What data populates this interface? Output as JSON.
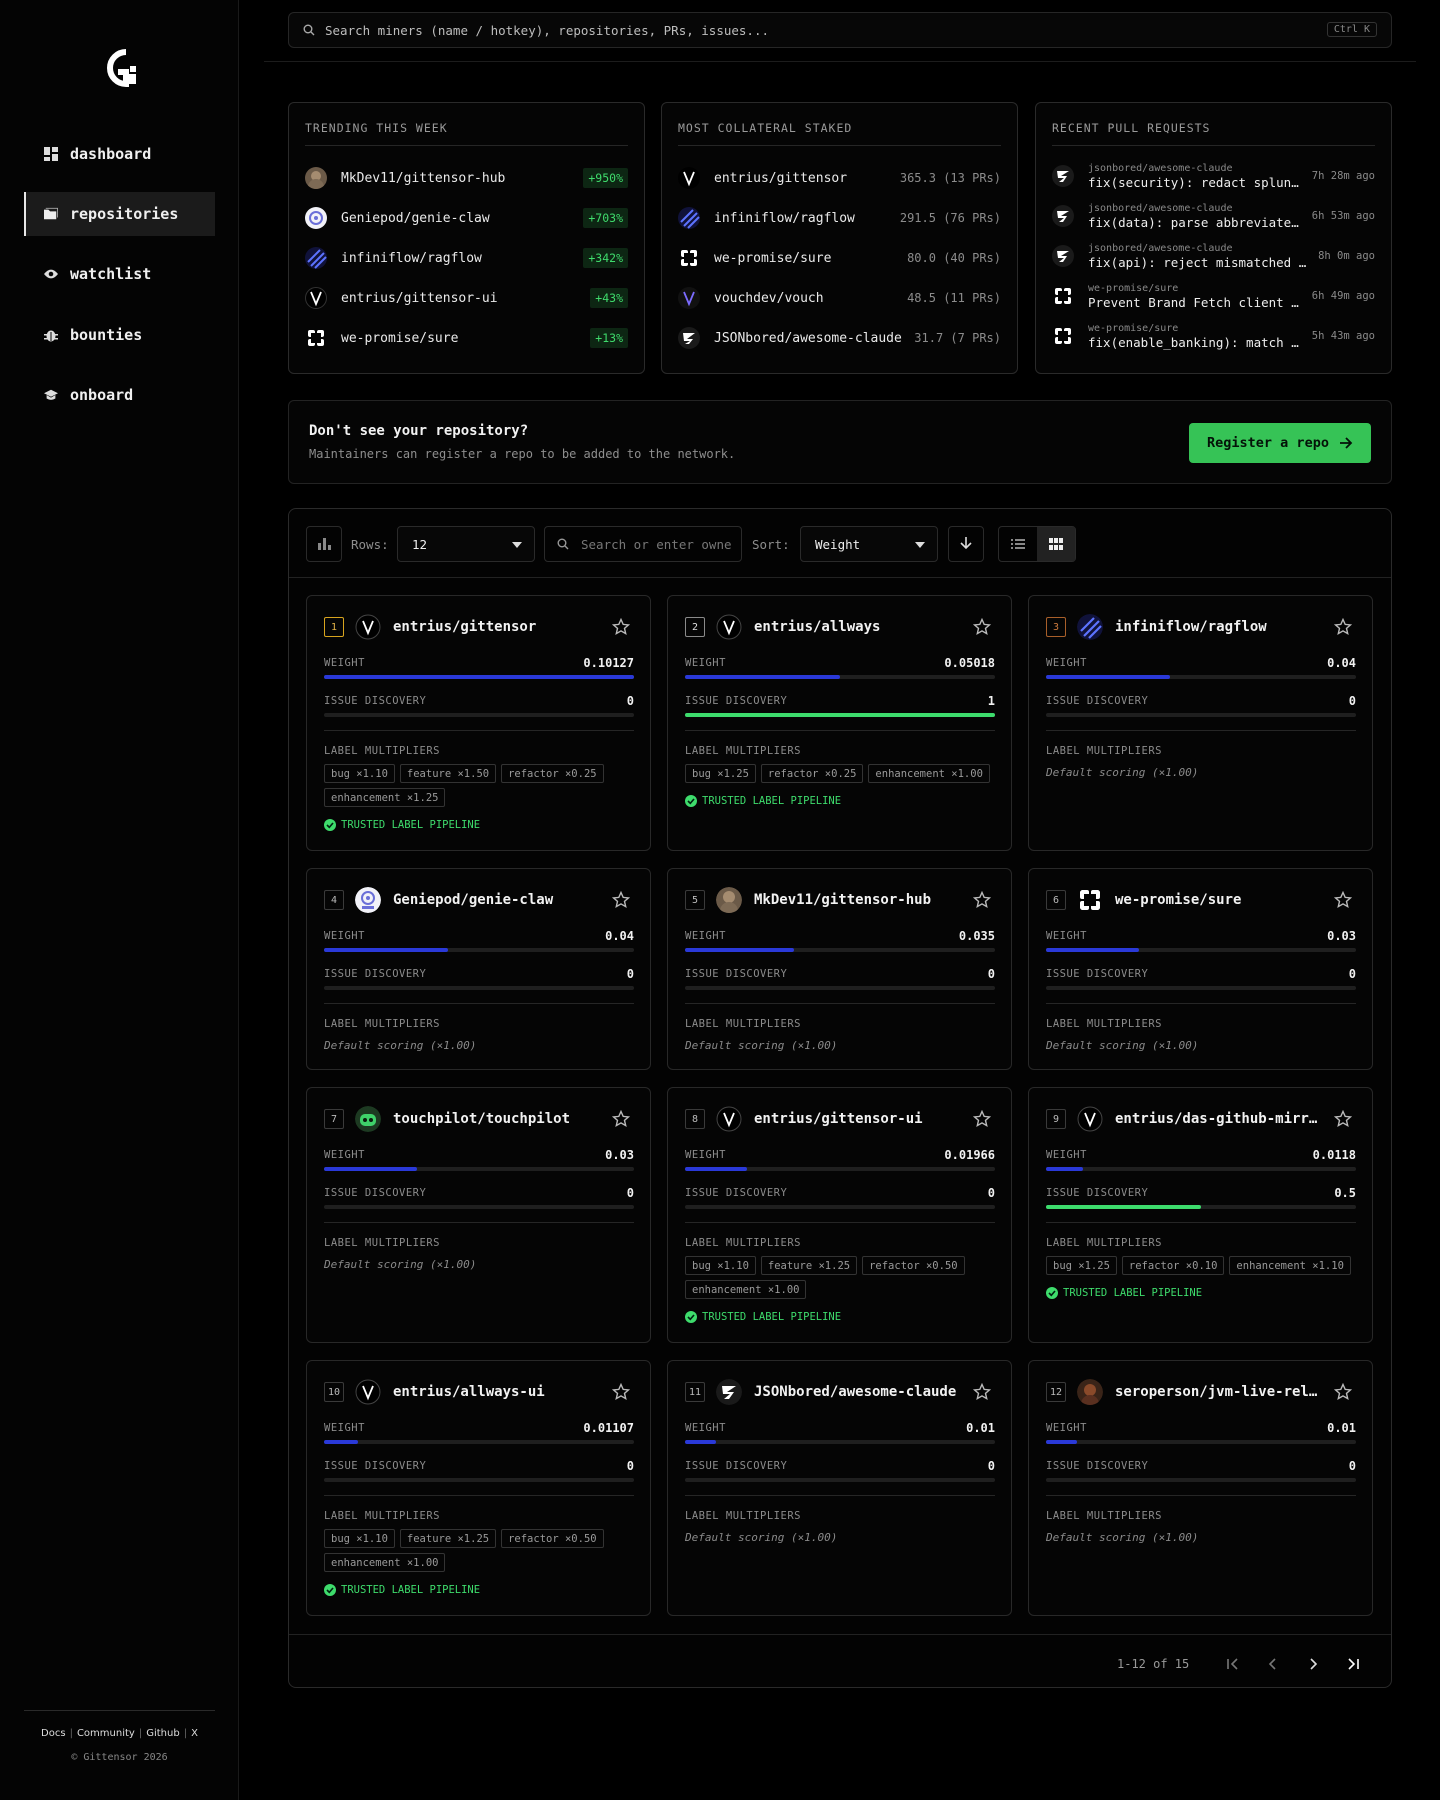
{
  "sidebar": {
    "nav": [
      {
        "label": "dashboard",
        "icon": "dashboard-icon"
      },
      {
        "label": "repositories",
        "icon": "folder-icon",
        "active": true
      },
      {
        "label": "watchlist",
        "icon": "eye-icon"
      },
      {
        "label": "bounties",
        "icon": "bug-icon"
      },
      {
        "label": "onboard",
        "icon": "graduation-cap-icon"
      }
    ],
    "footer_links": [
      "Docs",
      "Community",
      "Github",
      "X"
    ],
    "copyright": "© Gittensor 2026"
  },
  "search": {
    "placeholder": "Search miners (name / hotkey), repositories, PRs, issues...",
    "shortcut": "Ctrl K"
  },
  "trending": {
    "title": "TRENDING THIS WEEK",
    "items": [
      {
        "name": "MkDev11/gittensor-hub",
        "change": "+950%"
      },
      {
        "name": "Geniepod/genie-claw",
        "change": "+703%"
      },
      {
        "name": "infiniflow/ragflow",
        "change": "+342%"
      },
      {
        "name": "entrius/gittensor-ui",
        "change": "+43%"
      },
      {
        "name": "we-promise/sure",
        "change": "+13%"
      }
    ]
  },
  "collateral": {
    "title": "MOST COLLATERAL STAKED",
    "items": [
      {
        "name": "entrius/gittensor",
        "stake": "365.3 (13 PRs)"
      },
      {
        "name": "infiniflow/ragflow",
        "stake": "291.5 (76 PRs)"
      },
      {
        "name": "we-promise/sure",
        "stake": "80.0 (40 PRs)"
      },
      {
        "name": "vouchdev/vouch",
        "stake": "48.5 (11 PRs)"
      },
      {
        "name": "JSONbored/awesome-claude",
        "stake": "31.7 (7 PRs)"
      }
    ]
  },
  "recent_prs": {
    "title": "RECENT PULL REQUESTS",
    "items": [
      {
        "repo": "jsonbored/awesome-claude",
        "title": "fix(security): redact splunk hec tokens",
        "ago": "7h 28m ago"
      },
      {
        "repo": "jsonbored/awesome-claude",
        "title": "fix(data): parse abbreviated dates",
        "ago": "6h 53m ago"
      },
      {
        "repo": "jsonbored/awesome-claude",
        "title": "fix(api): reject mismatched payloads",
        "ago": "8h 0m ago"
      },
      {
        "repo": "we-promise/sure",
        "title": "Prevent Brand Fetch client errors",
        "ago": "6h 49m ago"
      },
      {
        "repo": "we-promise/sure",
        "title": "fix(enable_banking): match accounts",
        "ago": "5h 43m ago"
      }
    ]
  },
  "register": {
    "heading": "Don't see your repository?",
    "subtext": "Maintainers can register a repo to be added to the network.",
    "button": "Register a repo"
  },
  "toolbar": {
    "rows_label": "Rows:",
    "rows_value": "12",
    "filter_placeholder": "Search or enter owner",
    "sort_label": "Sort:",
    "sort_value": "Weight"
  },
  "card_labels": {
    "weight": "WEIGHT",
    "issue": "ISSUE DISCOVERY",
    "multipliers": "LABEL MULTIPLIERS",
    "default_scoring": "Default scoring (×1.00)",
    "trusted": "TRUSTED LABEL PIPELINE"
  },
  "repos": [
    {
      "rank": "1",
      "name": "entrius/gittensor",
      "weight": "0.10127",
      "weight_pct": 100,
      "issue": "0",
      "issue_pct": 0,
      "multipliers": [
        "bug ×1.10",
        "feature ×1.50",
        "refactor ×0.25",
        "enhancement ×1.25"
      ],
      "trusted": true
    },
    {
      "rank": "2",
      "name": "entrius/allways",
      "weight": "0.05018",
      "weight_pct": 50,
      "issue": "1",
      "issue_pct": 100,
      "multipliers": [
        "bug ×1.25",
        "refactor ×0.25",
        "enhancement ×1.00"
      ],
      "trusted": true
    },
    {
      "rank": "3",
      "name": "infiniflow/ragflow",
      "weight": "0.04",
      "weight_pct": 40,
      "issue": "0",
      "issue_pct": 0,
      "multipliers": [],
      "trusted": false
    },
    {
      "rank": "4",
      "name": "Geniepod/genie-claw",
      "weight": "0.04",
      "weight_pct": 40,
      "issue": "0",
      "issue_pct": 0,
      "multipliers": [],
      "trusted": false
    },
    {
      "rank": "5",
      "name": "MkDev11/gittensor-hub",
      "weight": "0.035",
      "weight_pct": 35,
      "issue": "0",
      "issue_pct": 0,
      "multipliers": [],
      "trusted": false
    },
    {
      "rank": "6",
      "name": "we-promise/sure",
      "weight": "0.03",
      "weight_pct": 30,
      "issue": "0",
      "issue_pct": 0,
      "multipliers": [],
      "trusted": false
    },
    {
      "rank": "7",
      "name": "touchpilot/touchpilot",
      "weight": "0.03",
      "weight_pct": 30,
      "issue": "0",
      "issue_pct": 0,
      "multipliers": [],
      "trusted": false
    },
    {
      "rank": "8",
      "name": "entrius/gittensor-ui",
      "weight": "0.01966",
      "weight_pct": 20,
      "issue": "0",
      "issue_pct": 0,
      "multipliers": [
        "bug ×1.10",
        "feature ×1.25",
        "refactor ×0.50",
        "enhancement ×1.00"
      ],
      "trusted": true
    },
    {
      "rank": "9",
      "name": "entrius/das-github-mirror",
      "weight": "0.0118",
      "weight_pct": 12,
      "issue": "0.5",
      "issue_pct": 50,
      "multipliers": [
        "bug ×1.25",
        "refactor ×0.10",
        "enhancement ×1.10"
      ],
      "trusted": true
    },
    {
      "rank": "10",
      "name": "entrius/allways-ui",
      "weight": "0.01107",
      "weight_pct": 11,
      "issue": "0",
      "issue_pct": 0,
      "multipliers": [
        "bug ×1.10",
        "feature ×1.25",
        "refactor ×0.50",
        "enhancement ×1.00"
      ],
      "trusted": true
    },
    {
      "rank": "11",
      "name": "JSONbored/awesome-claude",
      "weight": "0.01",
      "weight_pct": 10,
      "issue": "0",
      "issue_pct": 0,
      "multipliers": [],
      "trusted": false
    },
    {
      "rank": "12",
      "name": "seroperson/jvm-live-reload",
      "weight": "0.01",
      "weight_pct": 10,
      "issue": "0",
      "issue_pct": 0,
      "multipliers": [],
      "trusted": false
    }
  ],
  "pagination": {
    "info": "1-12 of 15"
  },
  "colors": {
    "accent_green": "#36c356",
    "weight_bar": "#2a39d8",
    "issue_bar": "#3ddc6d"
  }
}
